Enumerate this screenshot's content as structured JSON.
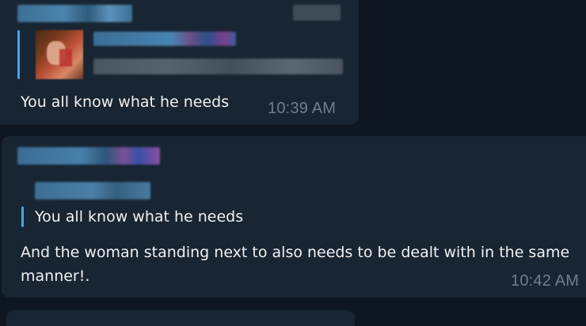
{
  "messages": [
    {
      "sender_name": "",
      "reply": {
        "author": "",
        "preview": "",
        "has_thumbnail": true
      },
      "text": "You all know what he needs",
      "time": "10:39 AM"
    },
    {
      "sender_name": "",
      "reply": {
        "author": "",
        "quote_text": "You all know what he needs"
      },
      "text": "And the woman standing next to also needs to be dealt with in the same manner!.",
      "time": "10:42 AM"
    }
  ],
  "colors": {
    "background": "#0e1621",
    "bubble": "#182533",
    "accent": "#4fa1e0",
    "timestamp": "#6d7f8f",
    "text": "#f1f1f1"
  }
}
